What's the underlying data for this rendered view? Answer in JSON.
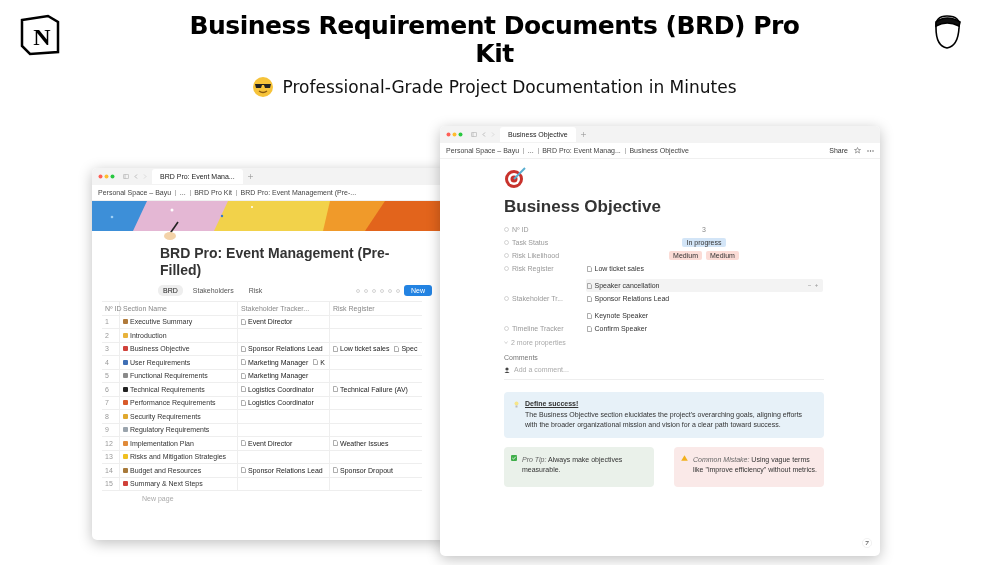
{
  "header": {
    "logo": "N",
    "title": "Business Requirement Documents (BRD) Pro Kit",
    "subtitle": "Professional-Grade Project Documentation in Minutes"
  },
  "back_window": {
    "tabs": [
      {
        "label": "BRD Pro: Event Mana...",
        "selected": true
      }
    ],
    "breadcrumbs": [
      "Personal Space – Bayu",
      "...",
      "BRD Pro Kit",
      "BRD Pro: Event Management (Pre-..."
    ],
    "title": "BRD Pro: Event Management (Pre-Filled)",
    "views": [
      {
        "label": "BRD",
        "selected": true
      },
      {
        "label": "Stakeholders",
        "selected": false
      },
      {
        "label": "Risk",
        "selected": false
      }
    ],
    "new_button": "New",
    "table": {
      "columns": [
        "Nº ID",
        "Section Name",
        "Stakeholder Tracker...",
        "Risk Register"
      ],
      "rows": [
        {
          "id": "1",
          "name": "Executive Summary",
          "color": "#b07a3a",
          "stakeholders": [
            "Event Director"
          ],
          "risks": []
        },
        {
          "id": "2",
          "name": "Introduction",
          "color": "#e8b33c",
          "stakeholders": [],
          "risks": []
        },
        {
          "id": "3",
          "name": "Business Objective",
          "color": "#d0413a",
          "stakeholders": [
            "Sponsor Relations Lead"
          ],
          "risks": [
            "Low ticket sales",
            "Spec"
          ]
        },
        {
          "id": "4",
          "name": "User Requirements",
          "color": "#3f6fb5",
          "stakeholders": [
            "Marketing Manager",
            "K"
          ],
          "risks": []
        },
        {
          "id": "5",
          "name": "Functional Requirements",
          "color": "#8a8a8a",
          "stakeholders": [
            "Marketing Manager"
          ],
          "risks": []
        },
        {
          "id": "6",
          "name": "Technical Requirements",
          "color": "#222222",
          "stakeholders": [
            "Logistics Coordinator"
          ],
          "risks": [
            "Technical Failure (AV)"
          ]
        },
        {
          "id": "7",
          "name": "Performance Requirements",
          "color": "#d85a2a",
          "stakeholders": [
            "Logistics Coordinator"
          ],
          "risks": []
        },
        {
          "id": "8",
          "name": "Security Requirements",
          "color": "#e0a82e",
          "stakeholders": [],
          "risks": []
        },
        {
          "id": "9",
          "name": "Regulatory Requirements",
          "color": "#9aa4ad",
          "stakeholders": [],
          "risks": []
        },
        {
          "id": "12",
          "name": "Implementation Plan",
          "color": "#e08a3a",
          "stakeholders": [
            "Event Director"
          ],
          "risks": [
            "Weather Issues"
          ]
        },
        {
          "id": "13",
          "name": "Risks and Mitigation Strategies",
          "color": "#f0c020",
          "stakeholders": [],
          "risks": []
        },
        {
          "id": "14",
          "name": "Budget and Resources",
          "color": "#a87a3a",
          "stakeholders": [
            "Sponsor Relations Lead"
          ],
          "risks": [
            "Sponsor Dropout"
          ]
        },
        {
          "id": "15",
          "name": "Summary & Next Steps",
          "color": "#d0413a",
          "stakeholders": [],
          "risks": []
        }
      ]
    },
    "new_page": "New page"
  },
  "front_window": {
    "tabs": [
      {
        "label": "Business Objective",
        "selected": true
      }
    ],
    "breadcrumbs": [
      "Personal Space – Bayu",
      "...",
      "BRD Pro: Event Manag...",
      "Business Objective"
    ],
    "share": "Share",
    "title": "Business Objective",
    "properties": [
      {
        "label": "Nº ID",
        "values": [
          {
            "kind": "text",
            "text": "3"
          }
        ]
      },
      {
        "label": "Task Status",
        "values": [
          {
            "kind": "tag",
            "text": "In progress",
            "color": "#d3e5f7"
          }
        ]
      },
      {
        "label": "Risk Likelihood",
        "values": [
          {
            "kind": "tag",
            "text": "Medium",
            "color": "#fbdcd6"
          },
          {
            "kind": "tag",
            "text": "Medium",
            "color": "#fbdcd6"
          }
        ]
      },
      {
        "label": "Risk Register",
        "values": [
          {
            "kind": "page",
            "text": "Low ticket sales",
            "hovered": false
          },
          {
            "kind": "page",
            "text": "Speaker cancellation",
            "hovered": true
          }
        ]
      },
      {
        "label": "Stakeholder Tr...",
        "values": [
          {
            "kind": "page",
            "text": "Sponsor Relations Lead",
            "hovered": false
          },
          {
            "kind": "page",
            "text": "Keynote Speaker",
            "hovered": false
          }
        ]
      },
      {
        "label": "Timeline Tracker",
        "values": [
          {
            "kind": "page",
            "text": "Confirm Speaker",
            "hovered": false
          }
        ]
      }
    ],
    "more_properties": "2 more properties",
    "comments_label": "Comments",
    "comment_placeholder": "Add a comment...",
    "callout": {
      "title": "Define success!",
      "text": "The Business Objective section elucidates the project's overarching goals, aligning efforts with the broader organizational mission and vision for a clear path toward success."
    },
    "tips": [
      {
        "kind": "tip",
        "label": "Pro Tip:",
        "text": "Always make objectives measurable."
      },
      {
        "kind": "mistake",
        "label": "Common Mistake:",
        "text": "Using vague terms like \"improve efficiency\" without metrics."
      }
    ]
  }
}
